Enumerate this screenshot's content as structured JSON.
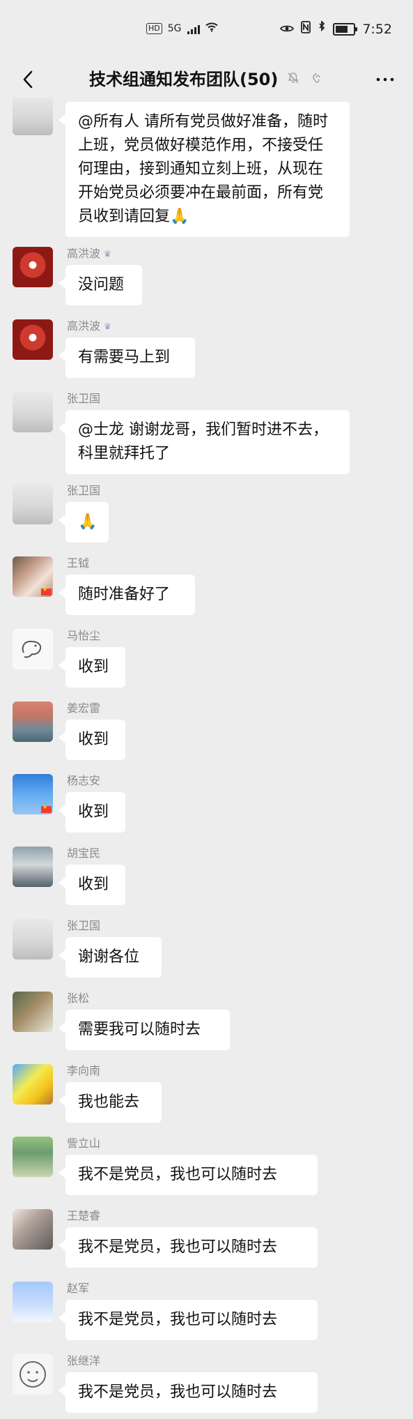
{
  "status_bar": {
    "left_badge": "HD",
    "network": "5G",
    "time": "7:52"
  },
  "header": {
    "title": "技术组通知发布团队(50)"
  },
  "icons": {
    "back": "back-icon",
    "bell_muted": "bell-muted-icon",
    "ear": "ear-icon",
    "more": "more-icon",
    "eye": "eye-icon",
    "nfc": "nfc-icon",
    "bluetooth": "bluetooth-icon",
    "battery": "battery-icon",
    "wifi": "wifi-icon"
  },
  "battery_level": 0.7,
  "messages": [
    {
      "name": "",
      "text": "@所有人  请所有党员做好准备，随时上班，党员做好模范作用，不接受任何理由，接到通知立刻上班，从现在开始党员必须要冲在最前面，所有党员收到请回复🙏"
    },
    {
      "name": "高洪波",
      "text": "没问题"
    },
    {
      "name": "高洪波",
      "text": "有需要马上到"
    },
    {
      "name": "张卫国",
      "text": "@士龙  谢谢龙哥，我们暂时进不去，科里就拜托了"
    },
    {
      "name": "张卫国",
      "text": "🙏"
    },
    {
      "name": "王钺",
      "text": "随时准备好了"
    },
    {
      "name": "马怡尘",
      "text": "收到"
    },
    {
      "name": "姜宏雷",
      "text": "收到"
    },
    {
      "name": "杨志安",
      "text": "收到"
    },
    {
      "name": "胡宝民",
      "text": "收到"
    },
    {
      "name": "张卫国",
      "text": "谢谢各位"
    },
    {
      "name": "张松",
      "text": "需要我可以随时去"
    },
    {
      "name": "李向南",
      "text": "我也能去"
    },
    {
      "name": "訾立山",
      "text": "我不是党员，我也可以随时去"
    },
    {
      "name": "王楚睿",
      "text": "我不是党员，我也可以随时去"
    },
    {
      "name": "赵军",
      "text": "我不是党员，我也可以随时去"
    },
    {
      "name": "张继洋",
      "text": "我不是党员，我也可以随时去"
    }
  ]
}
